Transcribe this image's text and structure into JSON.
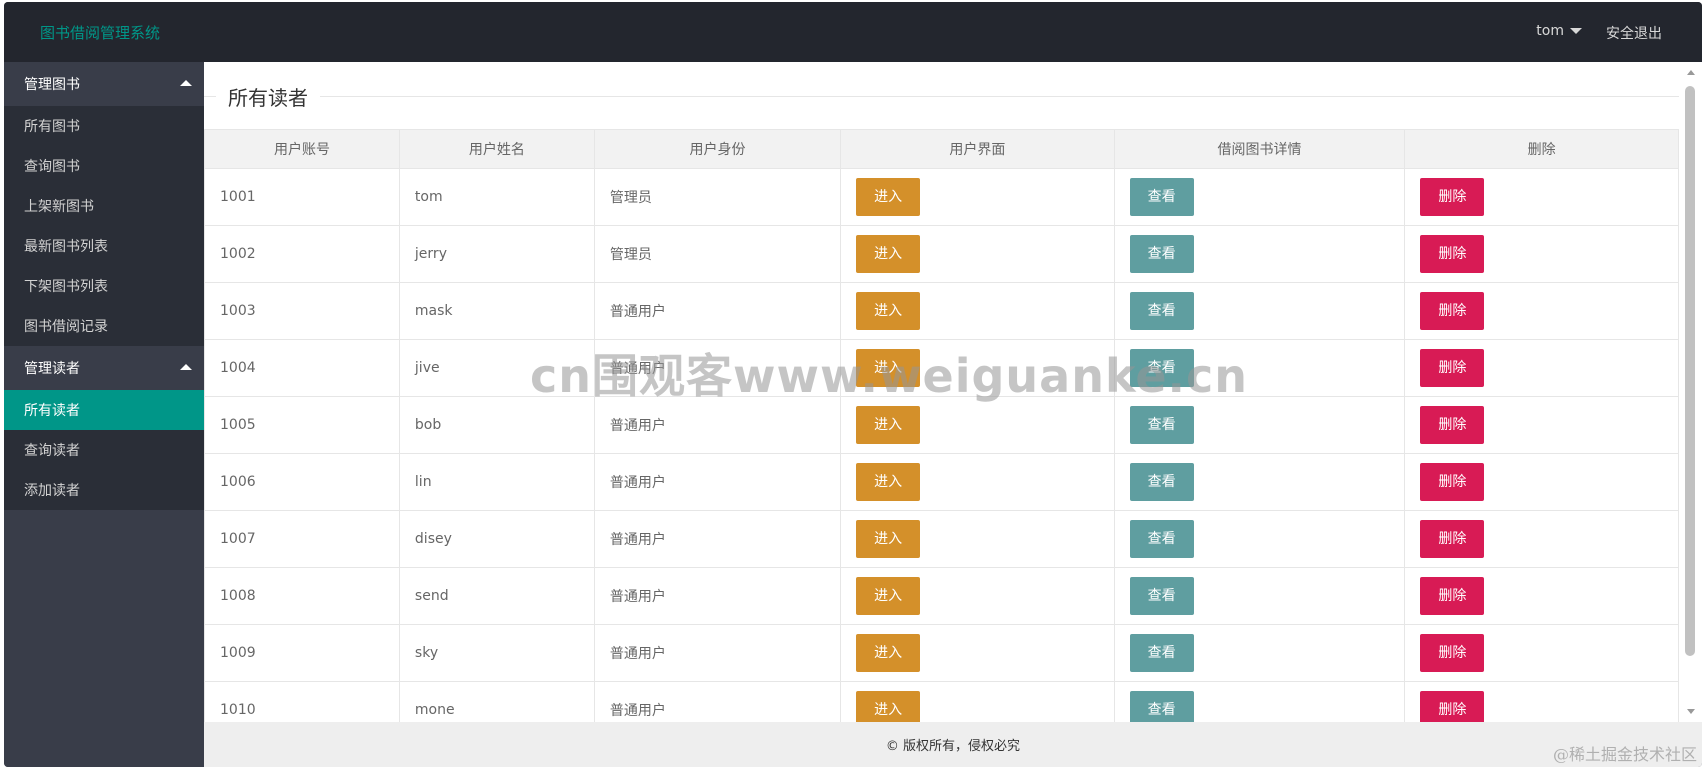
{
  "header": {
    "app_title": "图书借阅管理系统",
    "user_name": "tom",
    "logout_label": "安全退出"
  },
  "sidebar": {
    "groups": [
      {
        "title": "管理图书",
        "items": [
          "所有图书",
          "查询图书",
          "上架新图书",
          "最新图书列表",
          "下架图书列表",
          "图书借阅记录"
        ]
      },
      {
        "title": "管理读者",
        "items": [
          "所有读者",
          "查询读者",
          "添加读者"
        ]
      }
    ],
    "active_item": "所有读者"
  },
  "main": {
    "section_title": "所有读者",
    "table": {
      "columns": [
        "用户账号",
        "用户姓名",
        "用户身份",
        "用户界面",
        "借阅图书详情",
        "删除"
      ],
      "rows": [
        {
          "account": "1001",
          "name": "tom",
          "role": "管理员",
          "enter": "进入",
          "view": "查看",
          "delete": "删除"
        },
        {
          "account": "1002",
          "name": "jerry",
          "role": "管理员",
          "enter": "进入",
          "view": "查看",
          "delete": "删除"
        },
        {
          "account": "1003",
          "name": "mask",
          "role": "普通用户",
          "enter": "进入",
          "view": "查看",
          "delete": "删除"
        },
        {
          "account": "1004",
          "name": "jive",
          "role": "普通用户",
          "enter": "进入",
          "view": "查看",
          "delete": "删除"
        },
        {
          "account": "1005",
          "name": "bob",
          "role": "普通用户",
          "enter": "进入",
          "view": "查看",
          "delete": "删除"
        },
        {
          "account": "1006",
          "name": "lin",
          "role": "普通用户",
          "enter": "进入",
          "view": "查看",
          "delete": "删除"
        },
        {
          "account": "1007",
          "name": "disey",
          "role": "普通用户",
          "enter": "进入",
          "view": "查看",
          "delete": "删除"
        },
        {
          "account": "1008",
          "name": "send",
          "role": "普通用户",
          "enter": "进入",
          "view": "查看",
          "delete": "删除"
        },
        {
          "account": "1009",
          "name": "sky",
          "role": "普通用户",
          "enter": "进入",
          "view": "查看",
          "delete": "删除"
        },
        {
          "account": "1010",
          "name": "mone",
          "role": "普通用户",
          "enter": "进入",
          "view": "查看",
          "delete": "删除"
        }
      ]
    }
  },
  "footer": {
    "copyright": "© 版权所有，侵权必究"
  },
  "overlay": {
    "watermark": "cn围观客www.weiguanke.cn",
    "corner_mark": "@稀土掘金技术社区"
  },
  "colors": {
    "accent": "#009688",
    "enter_button": "#d4902a",
    "view_button": "#5f9ea0",
    "delete_button": "#d81b55"
  }
}
